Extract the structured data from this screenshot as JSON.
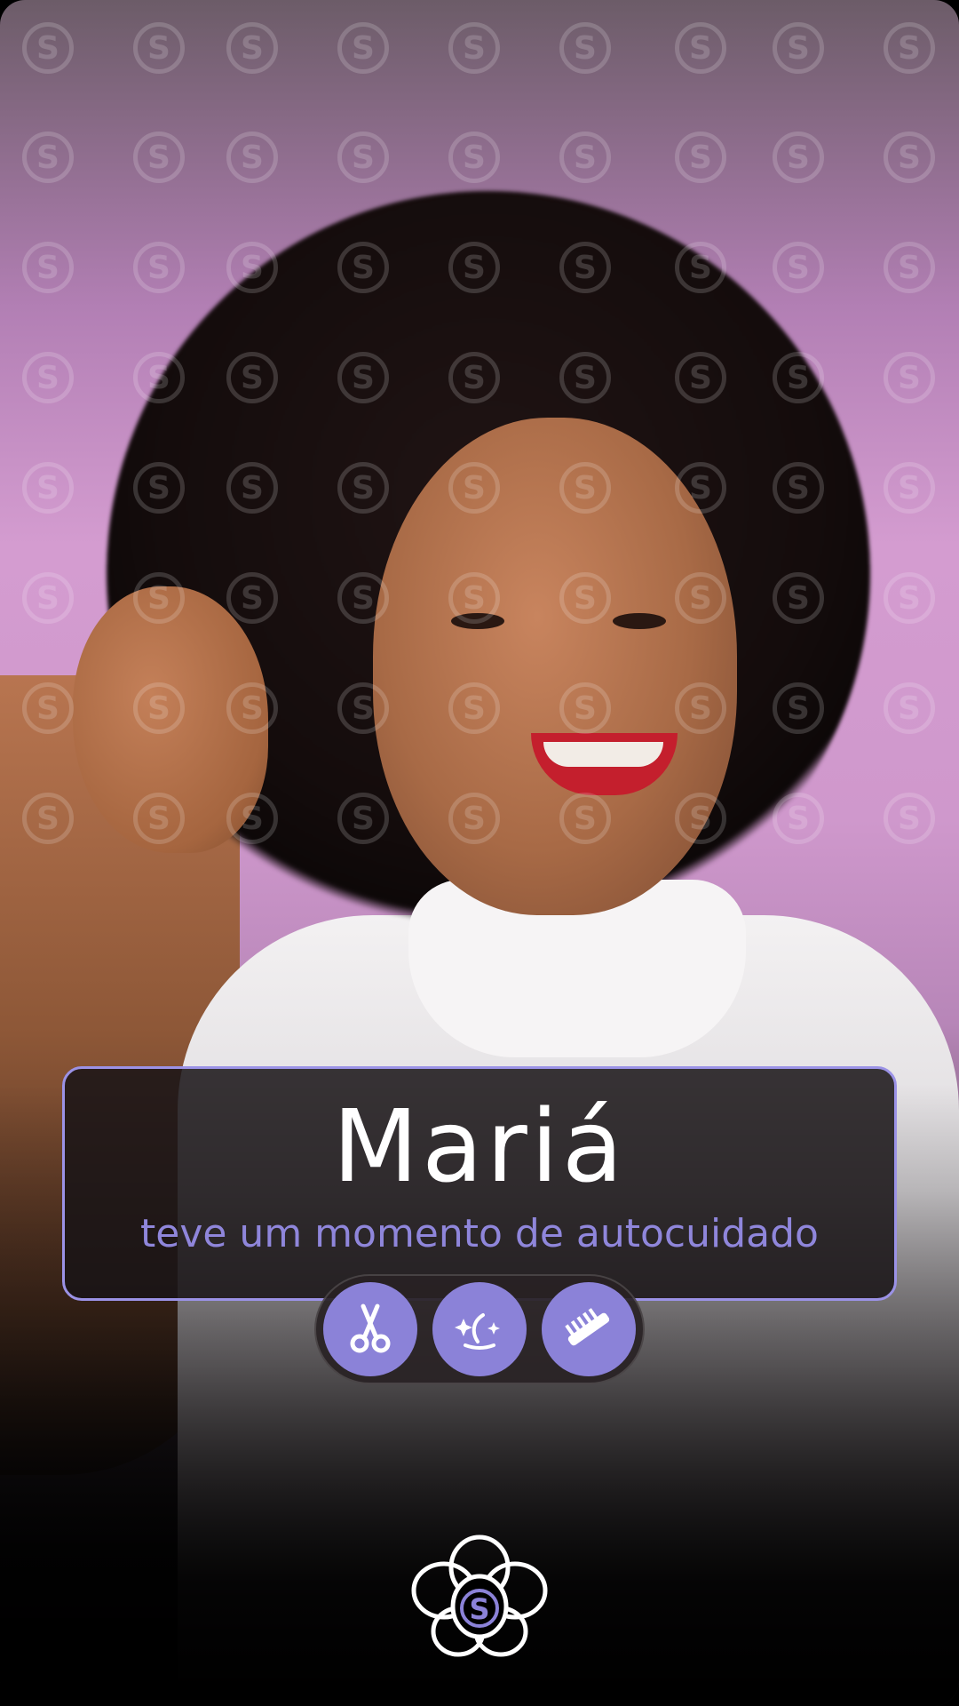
{
  "card": {
    "name": "Mariá",
    "subtitle": "teve um momento de autocuidado"
  },
  "services": [
    {
      "icon": "scissors-icon"
    },
    {
      "icon": "hair-treatment-sparkle-icon"
    },
    {
      "icon": "comb-icon"
    }
  ],
  "brand": {
    "logo_icon": "orchid-logo-icon",
    "accent_color": "#8b82d8",
    "border_color": "#9b92e6",
    "background_color": "#d49cd0"
  }
}
